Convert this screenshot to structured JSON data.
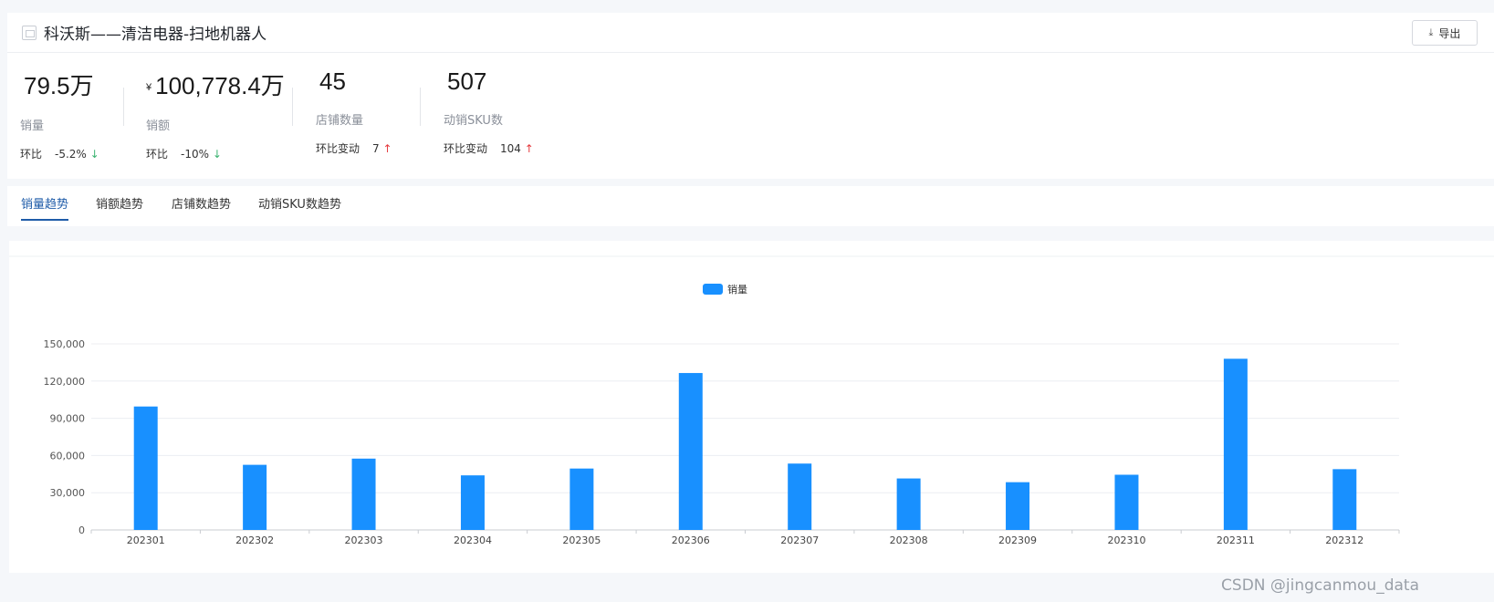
{
  "header": {
    "title": "科沃斯——清洁电器-扫地机器人",
    "export_label": "导出",
    "export_icon": "download-icon"
  },
  "metrics": [
    {
      "value": "79.5万",
      "currency": "",
      "label": "销量",
      "change_label": "环比",
      "change_value": "-5.2%",
      "direction": "down"
    },
    {
      "value": "100,778.4万",
      "currency": "¥",
      "label": "销额",
      "change_label": "环比",
      "change_value": "-10%",
      "direction": "down"
    },
    {
      "value": "45",
      "currency": "",
      "label": "店铺数量",
      "change_label": "环比变动",
      "change_value": "7",
      "direction": "up"
    },
    {
      "value": "507",
      "currency": "",
      "label": "动销SKU数",
      "change_label": "环比变动",
      "change_value": "104",
      "direction": "up"
    }
  ],
  "tabs": [
    {
      "label": "销量趋势",
      "active": true
    },
    {
      "label": "销额趋势",
      "active": false
    },
    {
      "label": "店铺数趋势",
      "active": false
    },
    {
      "label": "动销SKU数趋势",
      "active": false
    }
  ],
  "colors": {
    "bar": "#1890ff",
    "accent": "#1e5ba8",
    "down": "#3cb371",
    "up": "#e5393d"
  },
  "chart_data": {
    "type": "bar",
    "categories": [
      "202301",
      "202302",
      "202303",
      "202304",
      "202305",
      "202306",
      "202307",
      "202308",
      "202309",
      "202310",
      "202311",
      "202312"
    ],
    "series": [
      {
        "name": "销量",
        "values": [
          99500,
          52500,
          57500,
          44000,
          49500,
          126500,
          53500,
          41500,
          38500,
          44500,
          138000,
          49000
        ]
      }
    ],
    "ylim": [
      0,
      150000
    ],
    "yticks": [
      "0",
      "30,000",
      "60,000",
      "90,000",
      "120,000",
      "150,000"
    ],
    "ytick_values": [
      0,
      30000,
      60000,
      90000,
      120000,
      150000
    ],
    "legend": "top-center",
    "grid": true
  },
  "watermark": "CSDN @jingcanmou_data"
}
